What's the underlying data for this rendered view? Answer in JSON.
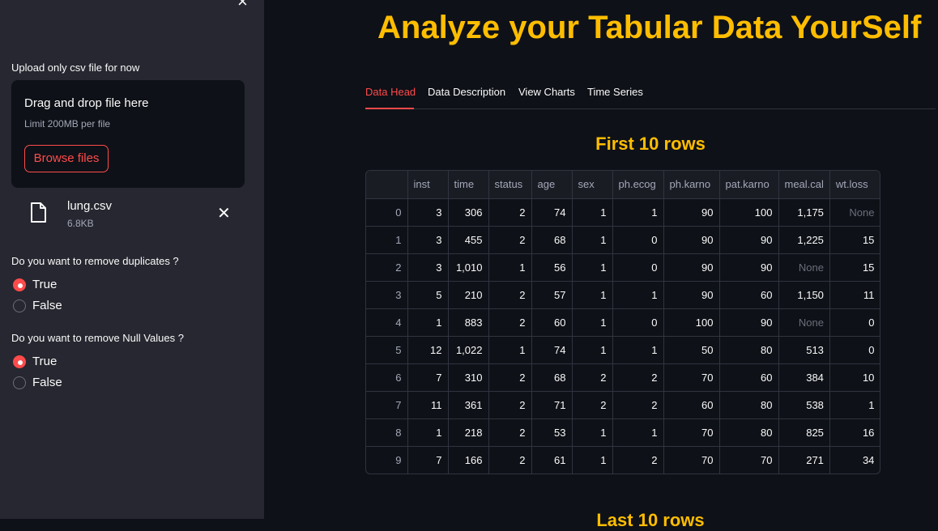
{
  "sidebar": {
    "upload_label": "Upload only csv file for now",
    "dropzone_title": "Drag and drop file here",
    "dropzone_limit": "Limit 200MB per file",
    "browse_label": "Browse files",
    "file_name": "lung.csv",
    "file_size": "6.8KB",
    "q1": {
      "label": "Do you want to remove duplicates ?",
      "options": [
        "True",
        "False"
      ],
      "selected": "True"
    },
    "q2": {
      "label": "Do you want to remove Null Values ?",
      "options": [
        "True",
        "False"
      ],
      "selected": "True"
    }
  },
  "main": {
    "title": "Analyze your Tabular Data YourSelf",
    "tabs": [
      "Data Head",
      "Data Description",
      "View Charts",
      "Time Series"
    ],
    "active_tab": "Data Head",
    "section_title": "First 10 rows",
    "next_section_title": "Last 10 rows"
  },
  "table": {
    "columns": [
      "",
      "inst",
      "time",
      "status",
      "age",
      "sex",
      "ph.ecog",
      "ph.karno",
      "pat.karno",
      "meal.cal",
      "wt.loss"
    ],
    "rows": [
      [
        "0",
        "3",
        "306",
        "2",
        "74",
        "1",
        "1",
        "90",
        "100",
        "1,175",
        "None"
      ],
      [
        "1",
        "3",
        "455",
        "2",
        "68",
        "1",
        "0",
        "90",
        "90",
        "1,225",
        "15"
      ],
      [
        "2",
        "3",
        "1,010",
        "1",
        "56",
        "1",
        "0",
        "90",
        "90",
        "None",
        "15"
      ],
      [
        "3",
        "5",
        "210",
        "2",
        "57",
        "1",
        "1",
        "90",
        "60",
        "1,150",
        "11"
      ],
      [
        "4",
        "1",
        "883",
        "2",
        "60",
        "1",
        "0",
        "100",
        "90",
        "None",
        "0"
      ],
      [
        "5",
        "12",
        "1,022",
        "1",
        "74",
        "1",
        "1",
        "50",
        "80",
        "513",
        "0"
      ],
      [
        "6",
        "7",
        "310",
        "2",
        "68",
        "2",
        "2",
        "70",
        "60",
        "384",
        "10"
      ],
      [
        "7",
        "11",
        "361",
        "2",
        "71",
        "2",
        "2",
        "60",
        "80",
        "538",
        "1"
      ],
      [
        "8",
        "1",
        "218",
        "2",
        "53",
        "1",
        "1",
        "70",
        "80",
        "825",
        "16"
      ],
      [
        "9",
        "7",
        "166",
        "2",
        "61",
        "1",
        "2",
        "70",
        "70",
        "271",
        "34"
      ]
    ]
  },
  "colors": {
    "accent": "#ff4b4b",
    "title": "#ffbd00",
    "background": "#0e1117",
    "sidebar": "#262730"
  }
}
